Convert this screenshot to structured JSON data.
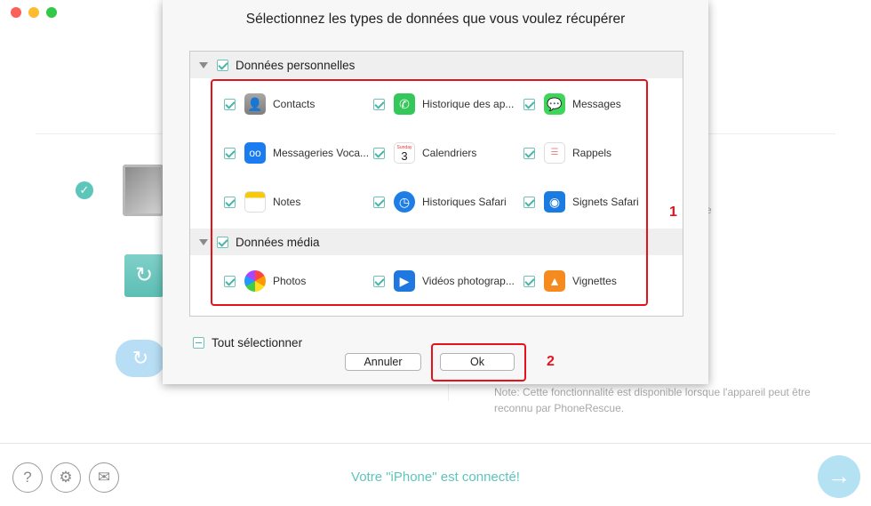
{
  "dialog": {
    "title": "Sélectionnez les types de données que vous voulez récupérer",
    "sections": [
      {
        "label": "Données personnelles",
        "items": [
          {
            "label": "Contacts",
            "icon": "contacts-icon"
          },
          {
            "label": "Historique des ap...",
            "icon": "phone-icon"
          },
          {
            "label": "Messages",
            "icon": "messages-icon"
          },
          {
            "label": "Messageries Voca...",
            "icon": "voicemail-icon"
          },
          {
            "label": "Calendriers",
            "icon": "calendar-icon",
            "icon_text": "3",
            "icon_subtext": "Sunday"
          },
          {
            "label": "Rappels",
            "icon": "reminders-icon"
          },
          {
            "label": "Notes",
            "icon": "notes-icon"
          },
          {
            "label": "Historiques Safari",
            "icon": "safari-history-icon"
          },
          {
            "label": "Signets Safari",
            "icon": "safari-bookmarks-icon"
          }
        ]
      },
      {
        "label": "Données média",
        "items": [
          {
            "label": "Photos",
            "icon": "photos-icon"
          },
          {
            "label": "Vidéos photograp...",
            "icon": "videos-icon"
          },
          {
            "label": "Vignettes",
            "icon": "thumbnails-icon"
          }
        ]
      }
    ],
    "select_all_label": "Tout sélectionner",
    "cancel_label": "Annuler",
    "ok_label": "Ok"
  },
  "annotations": {
    "box1": "1",
    "box2": "2"
  },
  "background": {
    "partial_text": "e",
    "note": "Note: Cette fonctionnalité est disponible lorsque l'appareil peut être reconnu par PhoneRescue.",
    "footer_status": "Votre \"iPhone\" est connecté!"
  },
  "colors": {
    "accent": "#5dc6ba",
    "annotation": "#e8111b"
  }
}
